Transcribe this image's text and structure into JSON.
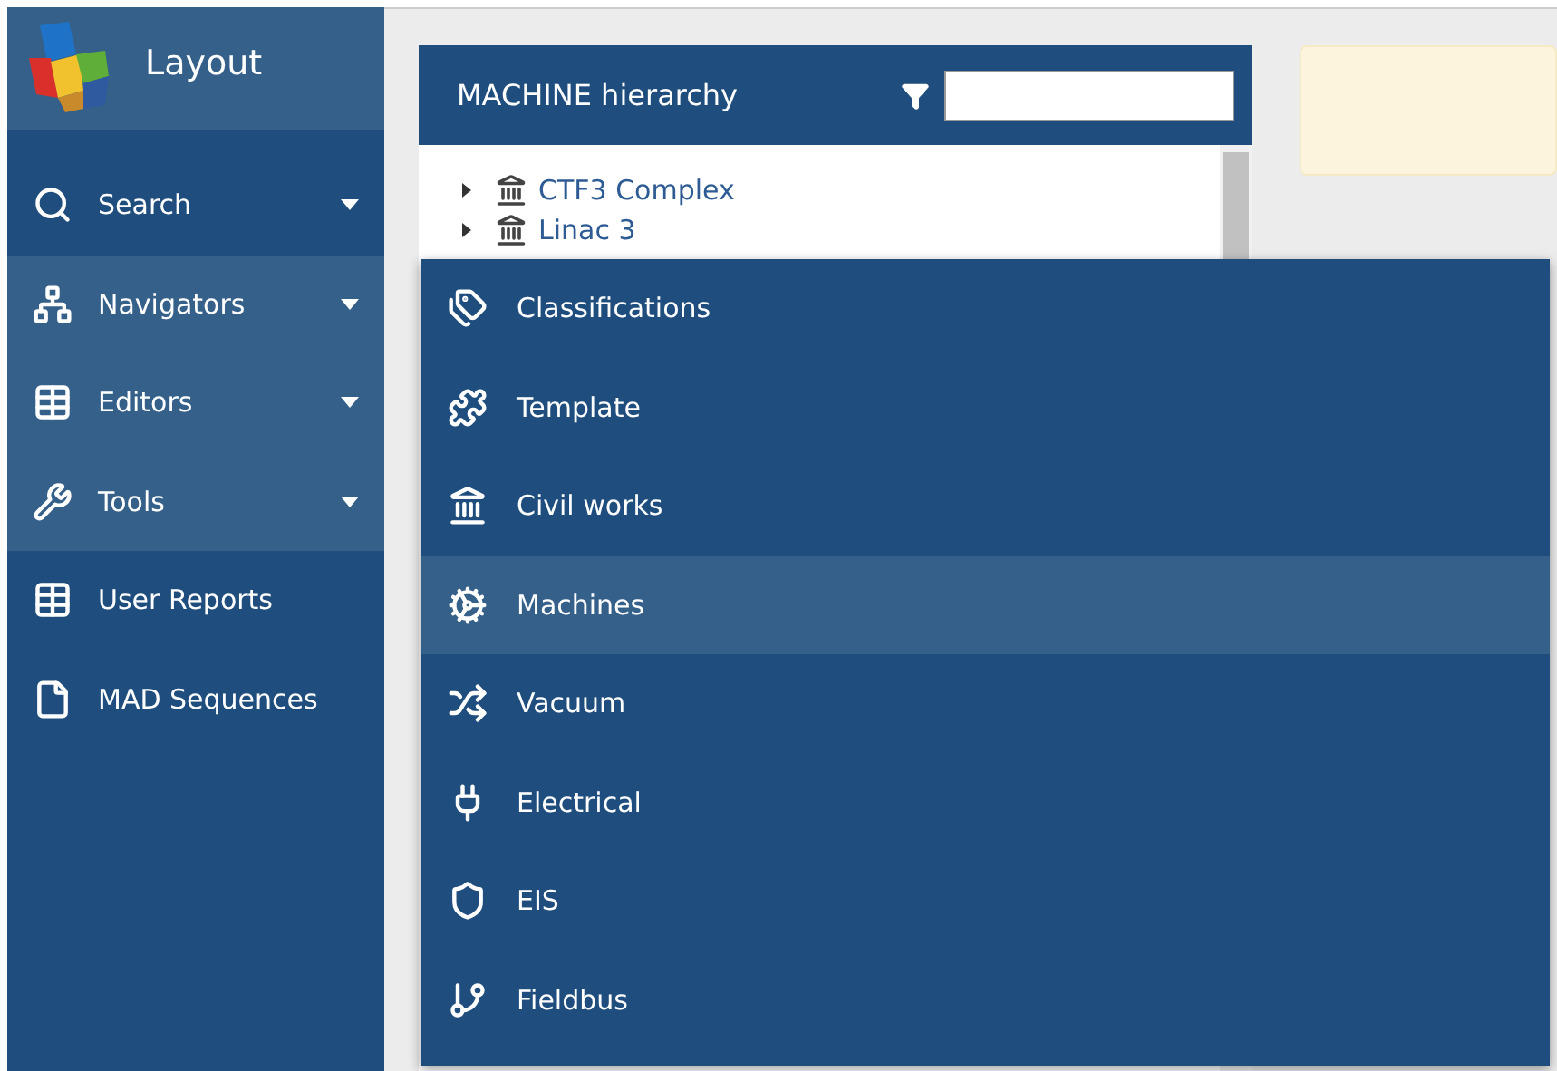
{
  "app": {
    "title": "Layout"
  },
  "sidebar": {
    "items": [
      {
        "label": "Search",
        "has_menu": true,
        "highlighted": false
      },
      {
        "label": "Navigators",
        "has_menu": true,
        "highlighted": true
      },
      {
        "label": "Editors",
        "has_menu": true,
        "highlighted": true
      },
      {
        "label": "Tools",
        "has_menu": true,
        "highlighted": true
      },
      {
        "label": "User Reports",
        "has_menu": false,
        "highlighted": false
      },
      {
        "label": "MAD Sequences",
        "has_menu": false,
        "highlighted": false
      }
    ]
  },
  "panel": {
    "title": "MACHINE hierarchy",
    "tree": [
      {
        "label": "CTF3 Complex",
        "expanded": false
      },
      {
        "label": "Linac 3",
        "expanded": false
      }
    ]
  },
  "submenu": {
    "items": [
      {
        "label": "Classifications",
        "selected": false
      },
      {
        "label": "Template",
        "selected": false
      },
      {
        "label": "Civil works",
        "selected": false
      },
      {
        "label": "Machines",
        "selected": true
      },
      {
        "label": "Vacuum",
        "selected": false
      },
      {
        "label": "Electrical",
        "selected": false
      },
      {
        "label": "EIS",
        "selected": false
      },
      {
        "label": "Fieldbus",
        "selected": false
      }
    ]
  }
}
